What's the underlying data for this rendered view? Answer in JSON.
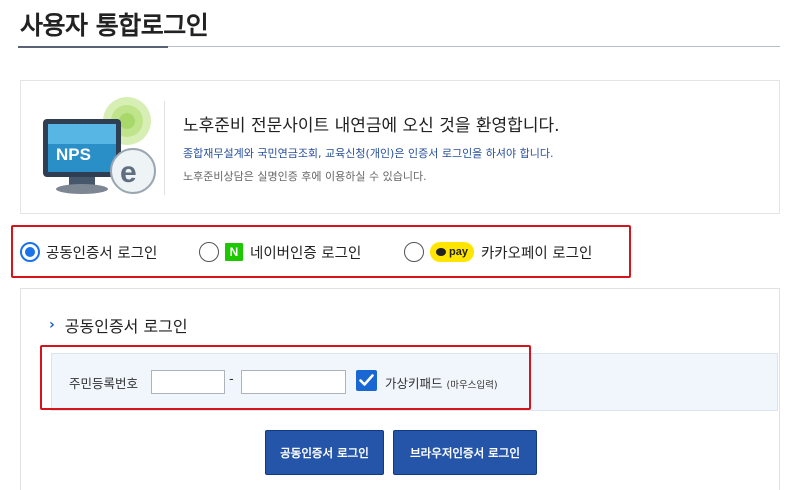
{
  "page": {
    "title": "사용자 통합로그인"
  },
  "welcome": {
    "logo_text": "NPS",
    "headline": "노후준비 전문사이트 내연금에 오신 것을 환영합니다.",
    "notice": "종합재무설계와 국민연금조회, 교육신청(개인)은 인증서 로그인을 하셔야 합니다.",
    "sub": "노후준비상담은 실명인증 후에 이용하실 수 있습니다."
  },
  "login_methods": {
    "selected": "공동인증서 로그인",
    "options": [
      {
        "label": "공동인증서 로그인",
        "checked": true
      },
      {
        "label": "네이버인증 로그인",
        "icon_text": "N",
        "checked": false
      },
      {
        "label": "카카오페이 로그인",
        "icon_text": "pay",
        "checked": false
      }
    ]
  },
  "cert_login": {
    "section_title": "공동인증서 로그인",
    "rrn_label": "주민등록번호",
    "rrn_first": "",
    "rrn_second": "",
    "separator": "-",
    "virtual_keypad_label": "가상키패드",
    "virtual_keypad_note": "(마우스입력)",
    "virtual_keypad_checked": true
  },
  "buttons": {
    "cert_login": "공동인증서 로그인",
    "browser_cert_login": "브라우저인증서 로그인"
  },
  "colors": {
    "accent": "#1a73e8",
    "highlight": "#d4161c",
    "button": "#2455a8",
    "naver": "#1ec800",
    "kakao": "#ffe500"
  }
}
